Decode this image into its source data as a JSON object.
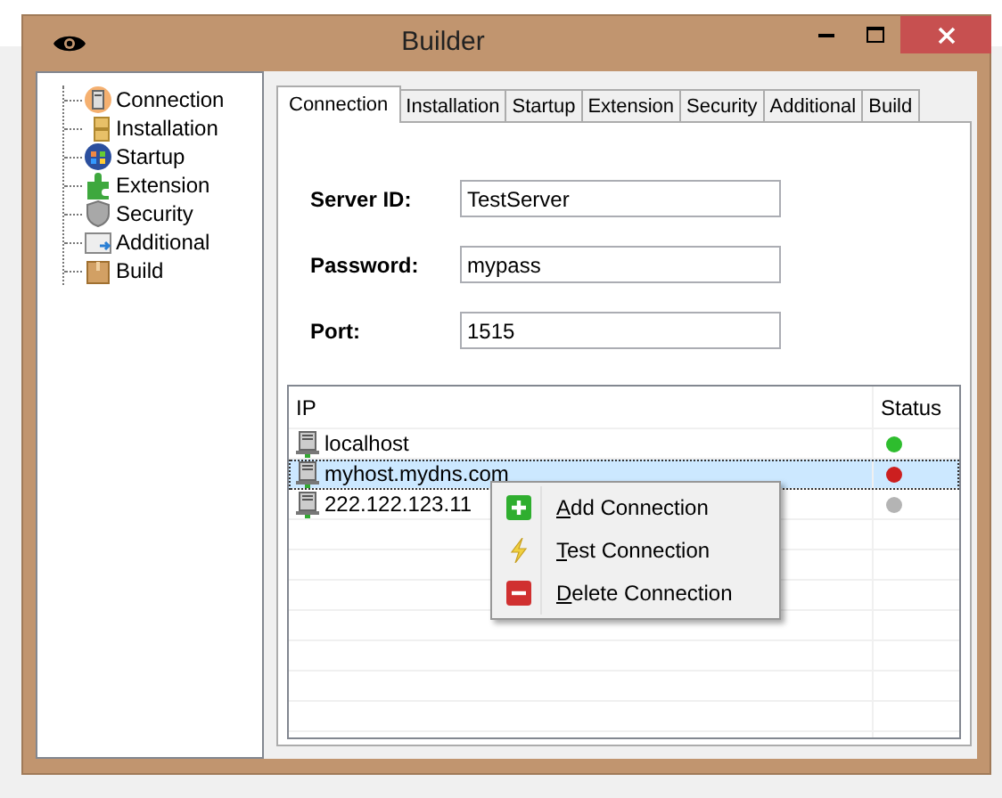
{
  "window": {
    "title": "Builder"
  },
  "sidebar": {
    "items": [
      {
        "label": "Connection",
        "selected": false
      },
      {
        "label": "Installation",
        "selected": false
      },
      {
        "label": "Startup",
        "selected": false
      },
      {
        "label": "Extension",
        "selected": false
      },
      {
        "label": "Security",
        "selected": false
      },
      {
        "label": "Additional",
        "selected": false
      },
      {
        "label": "Build",
        "selected": false
      }
    ]
  },
  "tabs": [
    {
      "label": "Connection",
      "selected": true
    },
    {
      "label": "Installation",
      "selected": false
    },
    {
      "label": "Startup",
      "selected": false
    },
    {
      "label": "Extension",
      "selected": false
    },
    {
      "label": "Security",
      "selected": false
    },
    {
      "label": "Additional",
      "selected": false
    },
    {
      "label": "Build",
      "selected": false
    }
  ],
  "fields": [
    {
      "label": "Server ID:",
      "value": "TestServer"
    },
    {
      "label": "Password:",
      "value": "mypass"
    },
    {
      "label": "Port:",
      "value": "1515"
    }
  ],
  "table": {
    "columns": [
      "IP",
      "Status"
    ],
    "rows": [
      {
        "ip": "localhost",
        "color": "#2ebd2e",
        "selected": false
      },
      {
        "ip": "myhost.mydns.com",
        "color": "#cc1f1f",
        "selected": true
      },
      {
        "ip": "222.122.123.11",
        "color": "#b4b4b4",
        "selected": false
      }
    ]
  },
  "context_menu": {
    "items": [
      {
        "label": "Add Connection",
        "kind": "add",
        "first_letter_underlined": true
      },
      {
        "label": "Test Connection",
        "kind": "test",
        "first_letter_underlined": true
      },
      {
        "label": "Delete Connection",
        "kind": "delete",
        "first_letter_underlined": true
      }
    ]
  }
}
